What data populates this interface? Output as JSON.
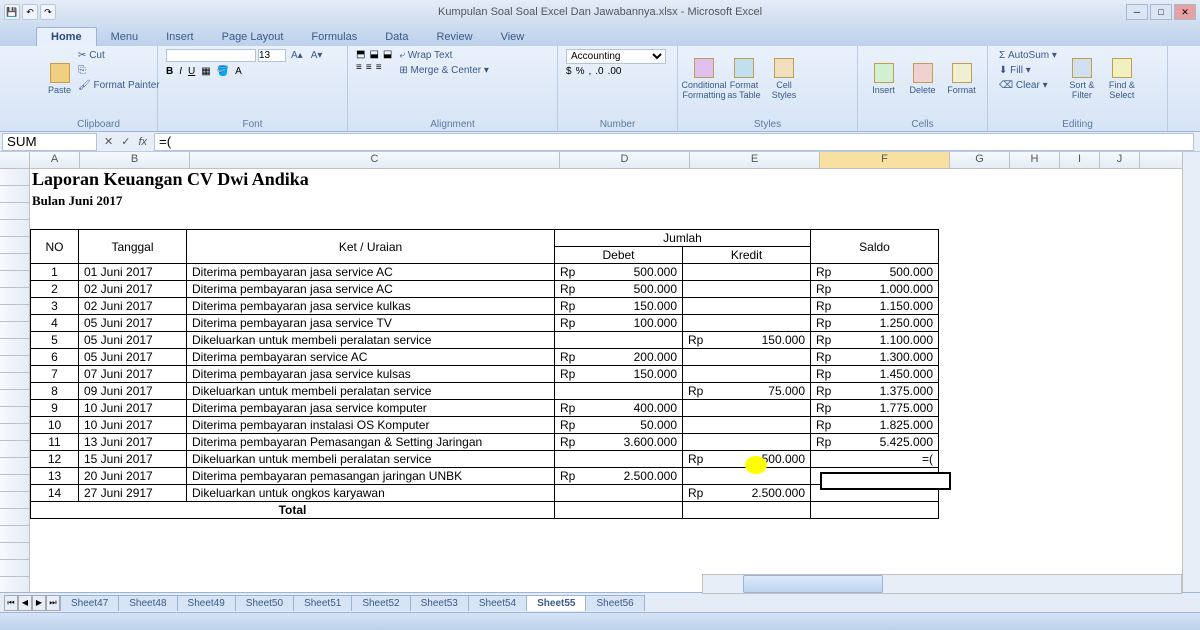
{
  "app": {
    "title": "Kumpulan Soal Soal Excel Dan Jawabannya.xlsx - Microsoft Excel"
  },
  "tabs": [
    "Home",
    "Menu",
    "Insert",
    "Page Layout",
    "Formulas",
    "Data",
    "Review",
    "View"
  ],
  "ribbon": {
    "clipboard": {
      "label": "Clipboard",
      "cut": "Cut",
      "copy": "Copy",
      "paste": "Paste",
      "painter": "Format Painter"
    },
    "font": {
      "label": "Font",
      "size": "13"
    },
    "alignment": {
      "label": "Alignment",
      "wrap": "Wrap Text",
      "merge": "Merge & Center"
    },
    "number": {
      "label": "Number",
      "format": "Accounting"
    },
    "styles": {
      "label": "Styles",
      "cond": "Conditional Formatting",
      "table": "Format as Table",
      "cell": "Cell Styles"
    },
    "cells": {
      "label": "Cells",
      "insert": "Insert",
      "delete": "Delete",
      "format": "Format"
    },
    "editing": {
      "label": "Editing",
      "autosum": "AutoSum",
      "fill": "Fill",
      "clear": "Clear",
      "sort": "Sort & Filter",
      "find": "Find & Select"
    }
  },
  "namebox": "SUM",
  "formula": "=(",
  "columns": [
    "A",
    "B",
    "C",
    "D",
    "E",
    "F",
    "G",
    "H",
    "I",
    "J"
  ],
  "report": {
    "title": "Laporan Keuangan CV Dwi Andika",
    "subtitle": "Bulan Juni 2017",
    "headers": {
      "no": "NO",
      "tgl": "Tanggal",
      "ket": "Ket / Uraian",
      "jml": "Jumlah",
      "debet": "Debet",
      "kredit": "Kredit",
      "saldo": "Saldo"
    },
    "total": "Total",
    "rows": [
      {
        "no": "1",
        "tgl": "01 Juni 2017",
        "ket": "Diterima pembayaran jasa service AC",
        "debet": "500.000",
        "kredit": "",
        "saldo": "500.000"
      },
      {
        "no": "2",
        "tgl": "02 Juni 2017",
        "ket": "Diterima pembayaran jasa service AC",
        "debet": "500.000",
        "kredit": "",
        "saldo": "1.000.000"
      },
      {
        "no": "3",
        "tgl": "02 Juni 2017",
        "ket": "Diterima pembayaran jasa service kulkas",
        "debet": "150.000",
        "kredit": "",
        "saldo": "1.150.000"
      },
      {
        "no": "4",
        "tgl": "05 Juni 2017",
        "ket": "Diterima pembayaran jasa service TV",
        "debet": "100.000",
        "kredit": "",
        "saldo": "1.250.000"
      },
      {
        "no": "5",
        "tgl": "05 Juni 2017",
        "ket": "Dikeluarkan untuk membeli peralatan service",
        "debet": "",
        "kredit": "150.000",
        "saldo": "1.100.000"
      },
      {
        "no": "6",
        "tgl": "05 Juni 2017",
        "ket": "Diterima pembayaran service AC",
        "debet": "200.000",
        "kredit": "",
        "saldo": "1.300.000"
      },
      {
        "no": "7",
        "tgl": "07 Juni 2017",
        "ket": "Diterima pembayaran jasa service kulsas",
        "debet": "150.000",
        "kredit": "",
        "saldo": "1.450.000"
      },
      {
        "no": "8",
        "tgl": "09 Juni 2017",
        "ket": "Dikeluarkan untuk membeli peralatan service",
        "debet": "",
        "kredit": "75.000",
        "saldo": "1.375.000"
      },
      {
        "no": "9",
        "tgl": "10 Juni 2017",
        "ket": "Diterima pembayaran jasa service komputer",
        "debet": "400.000",
        "kredit": "",
        "saldo": "1.775.000"
      },
      {
        "no": "10",
        "tgl": "10 Juni 2017",
        "ket": "Diterima pembayaran instalasi OS Komputer",
        "debet": "50.000",
        "kredit": "",
        "saldo": "1.825.000"
      },
      {
        "no": "11",
        "tgl": "13 Juni 2017",
        "ket": "Diterima pembayaran Pemasangan & Setting Jaringan",
        "debet": "3.600.000",
        "kredit": "",
        "saldo": "5.425.000"
      },
      {
        "no": "12",
        "tgl": "15 Juni 2017",
        "ket": "Dikeluarkan untuk membeli peralatan service",
        "debet": "",
        "kredit": "500.000",
        "saldo": "=("
      },
      {
        "no": "13",
        "tgl": "20 Juni 2017",
        "ket": "Diterima pembayaran pemasangan jaringan UNBK",
        "debet": "2.500.000",
        "kredit": "",
        "saldo": ""
      },
      {
        "no": "14",
        "tgl": "27 Juni 2917",
        "ket": "Dikeluarkan untuk ongkos karyawan",
        "debet": "",
        "kredit": "2.500.000",
        "saldo": ""
      }
    ]
  },
  "sheets": [
    "Sheet47",
    "Sheet48",
    "Sheet49",
    "Sheet50",
    "Sheet51",
    "Sheet52",
    "Sheet53",
    "Sheet54",
    "Sheet55",
    "Sheet56"
  ],
  "active_sheet": "Sheet55",
  "rp": "Rp"
}
